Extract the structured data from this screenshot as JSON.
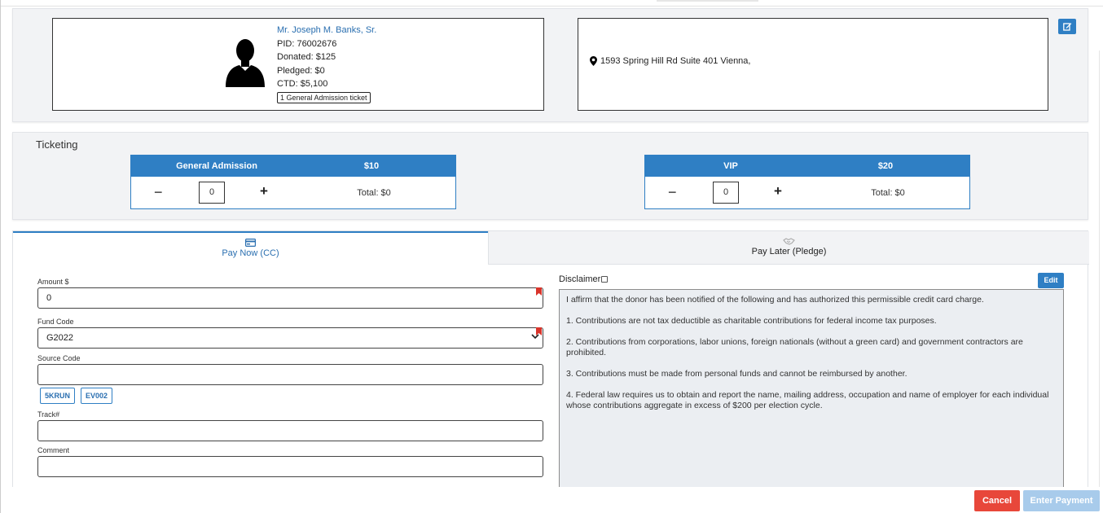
{
  "donor": {
    "name": "Mr. Joseph M. Banks, Sr.",
    "pid": "PID: 76002676",
    "donated": "Donated: $125",
    "pledged": "Pledged: $0",
    "ctd": "CTD: $5,100",
    "ticket_badge": "1 General Admission ticket",
    "address": "1593 Spring Hill Rd Suite 401 Vienna,"
  },
  "ticketing": {
    "title": "Ticketing",
    "tickets": [
      {
        "name": "General Admission",
        "price": "$10",
        "minus": "−",
        "qty": "0",
        "plus": "+",
        "total": "Total: $0"
      },
      {
        "name": "VIP",
        "price": "$20",
        "minus": "−",
        "qty": "0",
        "plus": "+",
        "total": "Total: $0"
      }
    ]
  },
  "payment_tabs": {
    "pay_now": "Pay Now (CC)",
    "pay_later": "Pay Later (Pledge)"
  },
  "form": {
    "amount_label": "Amount $",
    "amount_value": "0",
    "fund_code_label": "Fund Code",
    "fund_code_value": "G2022",
    "source_code_label": "Source Code",
    "source_code_value": "",
    "source_chips": [
      "5KRUN",
      "EV002"
    ],
    "track_label": "Track#",
    "track_value": "",
    "comment_label": "Comment",
    "comment_value": ""
  },
  "disclaimer": {
    "label": "Disclaimer",
    "edit_label": "Edit",
    "paragraphs": [
      "I affirm that the donor has been notified of the following and has authorized this permissible credit card charge.",
      "1. Contributions are not tax deductible as charitable contributions for federal income tax purposes.",
      "2. Contributions from corporations, labor unions, foreign nationals (without a green card) and government contractors are prohibited.",
      "3. Contributions must be made from personal funds and cannot be reimbursed by another.",
      "4. Federal law requires us to obtain and report the name, mailing address, occupation and name of employer for each individual whose contributions aggregate in excess of $200 per election cycle."
    ]
  },
  "footer": {
    "cancel": "Cancel",
    "enter_payment": "Enter Payment"
  },
  "colors": {
    "primary": "#2f7fc4",
    "danger": "#e8473a",
    "disabled": "#a8cbeb",
    "required_flag": "#d9342b"
  }
}
